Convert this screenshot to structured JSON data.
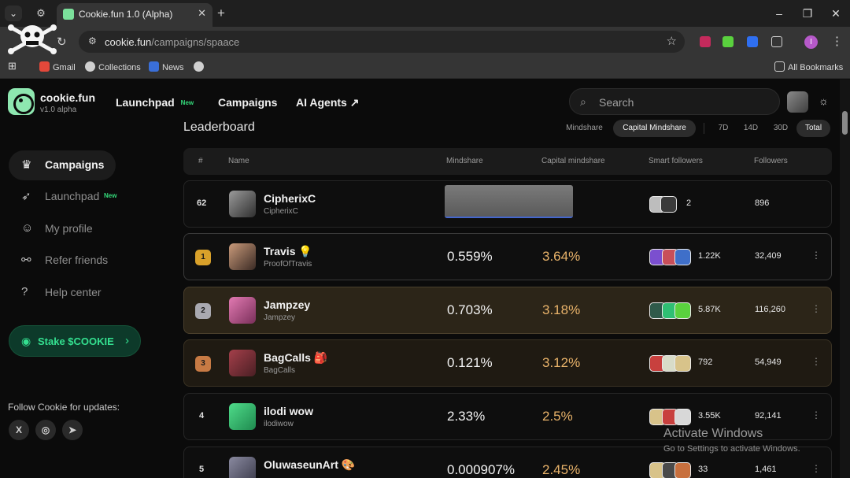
{
  "browser": {
    "tab_title": "Cookie.fun 1.0 (Alpha)",
    "url_host": "cookie.fun",
    "url_path": "/campaigns/spaace",
    "profile_initial": "I",
    "bookmarks": [
      "Gmail",
      "Collections",
      "News"
    ],
    "all_bookmarks": "All Bookmarks"
  },
  "header": {
    "brand": "cookie.fun",
    "version": "v1.0 alpha",
    "nav": [
      {
        "label": "Launchpad",
        "badge": "New"
      },
      {
        "label": "Campaigns"
      },
      {
        "label": "AI Agents ↗"
      }
    ],
    "search_placeholder": "Search"
  },
  "sidebar": {
    "items": [
      {
        "label": "Campaigns",
        "icon": "trophy-icon",
        "active": true
      },
      {
        "label": "Launchpad",
        "icon": "rocket-icon",
        "badge": "New"
      },
      {
        "label": "My profile",
        "icon": "user-icon"
      },
      {
        "label": "Refer friends",
        "icon": "link-icon"
      },
      {
        "label": "Help center",
        "icon": "help-icon"
      }
    ],
    "stake_label": "Stake $COOKIE",
    "follow_label": "Follow Cookie for updates:"
  },
  "leaderboard": {
    "title": "Leaderboard",
    "modes": [
      "Mindshare",
      "Capital Mindshare"
    ],
    "active_mode": "Capital Mindshare",
    "periods": [
      "7D",
      "14D",
      "30D",
      "Total"
    ],
    "active_period": "Total",
    "columns": [
      "#",
      "Name",
      "Mindshare",
      "Capital mindshare",
      "Smart followers",
      "Followers"
    ],
    "rows": [
      {
        "rank": "62",
        "name": "CipherixC",
        "handle": "CipherixC",
        "mindshare": "",
        "capital": "",
        "smart_followers": "2",
        "followers": "896"
      },
      {
        "rank": "1",
        "name": "Travis 💡",
        "handle": "ProofOfTravis",
        "mindshare": "0.559%",
        "capital": "3.64%",
        "smart_followers": "1.22K",
        "followers": "32,409"
      },
      {
        "rank": "2",
        "name": "Jampzey",
        "handle": "Jampzey",
        "mindshare": "0.703%",
        "capital": "3.18%",
        "smart_followers": "5.87K",
        "followers": "116,260"
      },
      {
        "rank": "3",
        "name": "BagCalls 🎒",
        "handle": "BagCalls",
        "mindshare": "0.121%",
        "capital": "3.12%",
        "smart_followers": "792",
        "followers": "54,949"
      },
      {
        "rank": "4",
        "name": "ilodi wow",
        "handle": "ilodiwow",
        "mindshare": "2.33%",
        "capital": "2.5%",
        "smart_followers": "3.55K",
        "followers": "92,141"
      },
      {
        "rank": "5",
        "name": "OluwaseunArt 🎨",
        "handle": "",
        "mindshare": "0.000907%",
        "capital": "2.45%",
        "smart_followers": "33",
        "followers": "1,461"
      }
    ]
  },
  "watermark": {
    "line1": "Activate Windows",
    "line2": "Go to Settings to activate Windows."
  }
}
